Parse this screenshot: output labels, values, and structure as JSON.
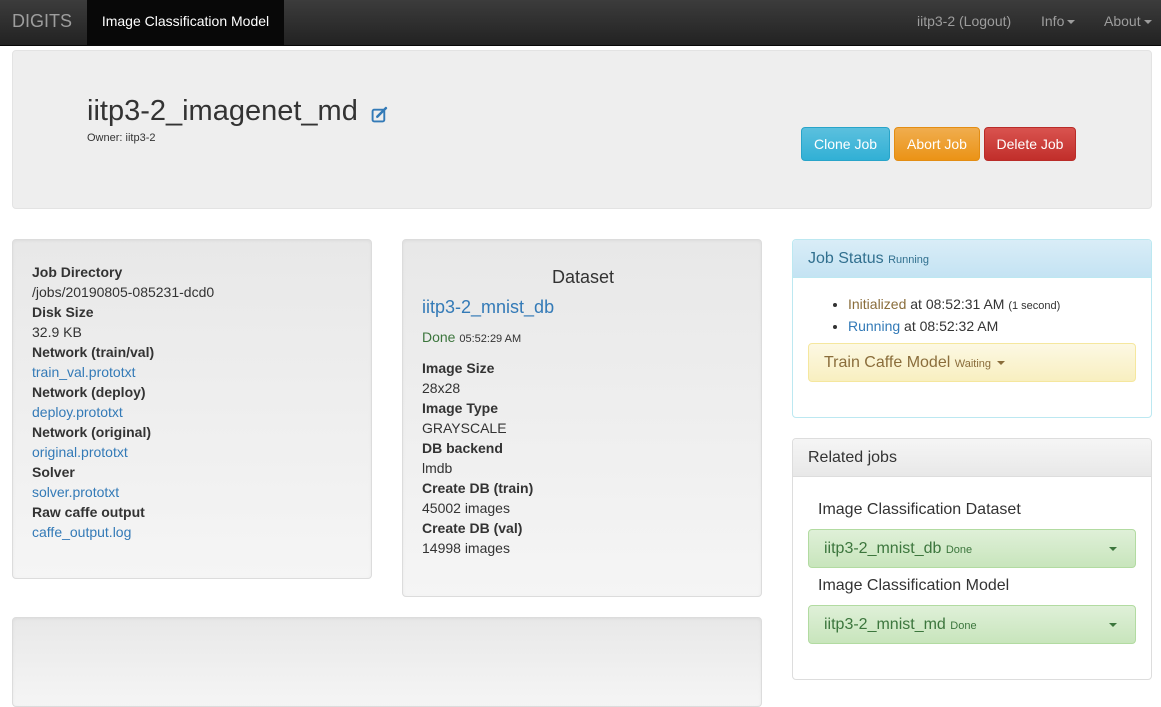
{
  "navbar": {
    "brand": "DIGITS",
    "active_tab": "Image Classification Model",
    "user_link": "iitp3-2 (Logout)",
    "info_menu": "Info",
    "about_menu": "About"
  },
  "header": {
    "job_name": "iitp3-2_imagenet_md",
    "owner": "Owner: iitp3-2",
    "clone_button": "Clone Job",
    "abort_button": "Abort Job",
    "delete_button": "Delete Job"
  },
  "job_info": {
    "job_directory_label": "Job Directory",
    "job_directory_value": "/jobs/20190805-085231-dcd0",
    "disk_size_label": "Disk Size",
    "disk_size_value": "32.9 KB",
    "network_trainval_label": "Network (train/val)",
    "network_trainval_link": "train_val.prototxt",
    "network_deploy_label": "Network (deploy)",
    "network_deploy_link": "deploy.prototxt",
    "network_original_label": "Network (original)",
    "network_original_link": "original.prototxt",
    "solver_label": "Solver",
    "solver_link": "solver.prototxt",
    "raw_output_label": "Raw caffe output",
    "raw_output_link": "caffe_output.log"
  },
  "dataset": {
    "heading": "Dataset",
    "name": "iitp3-2_mnist_db",
    "status": "Done",
    "status_time": "05:52:29 AM",
    "image_size_label": "Image Size",
    "image_size_value": "28x28",
    "image_type_label": "Image Type",
    "image_type_value": "GRAYSCALE",
    "db_backend_label": "DB backend",
    "db_backend_value": "lmdb",
    "create_train_label": "Create DB (train)",
    "create_train_value": "45002 images",
    "create_val_label": "Create DB (val)",
    "create_val_value": "14998 images"
  },
  "job_status": {
    "title": "Job Status",
    "state": "Running",
    "events": [
      {
        "status": "Initialized",
        "at": "at 08:52:31 AM",
        "extra": "(1 second)"
      },
      {
        "status": "Running",
        "at": "at 08:52:32 AM"
      }
    ],
    "stage_name": "Train Caffe Model",
    "stage_status": "Waiting"
  },
  "related_jobs": {
    "title": "Related jobs",
    "groups": [
      {
        "label": "Image Classification Dataset",
        "job": "iitp3-2_mnist_db",
        "status": "Done"
      },
      {
        "label": "Image Classification Model",
        "job": "iitp3-2_mnist_md",
        "status": "Done"
      }
    ]
  },
  "colors": {
    "navbar": "#222222",
    "info_button": "#5bc0de",
    "warning_button": "#f0ad4e",
    "danger_button": "#d9534f",
    "link": "#337ab7",
    "success_text": "#3c763d"
  }
}
